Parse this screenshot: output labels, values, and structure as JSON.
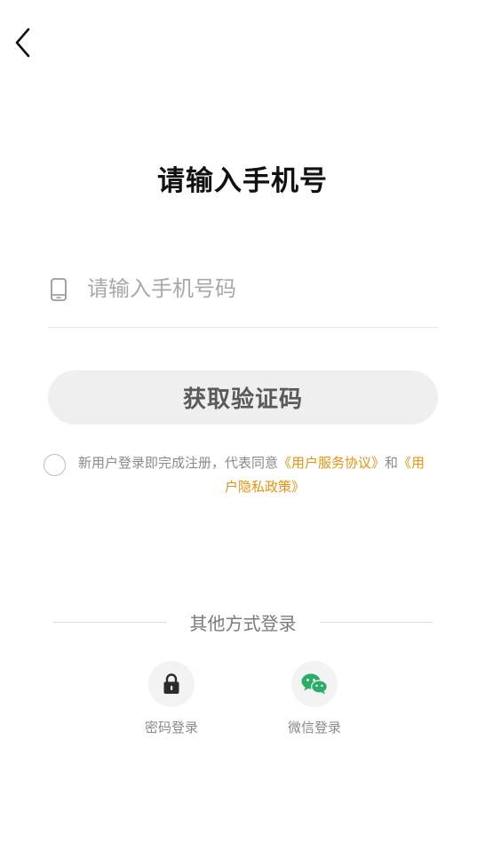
{
  "header": {
    "back_icon": "chevron-left-icon"
  },
  "title": "请输入手机号",
  "phone": {
    "icon": "mobile-phone-icon",
    "value": "",
    "placeholder": "请输入手机号码"
  },
  "get_code_button": "获取验证码",
  "agreement": {
    "checked": false,
    "prefix": "新用户登录即完成注册，代表同意",
    "terms_link": "《用户服务协议》",
    "joiner": "和",
    "privacy_link_part1": "《用",
    "privacy_link_part2": "户隐私政策》",
    "link_color": "#e8930f"
  },
  "other_login": {
    "divider_label": "其他方式登录",
    "options": [
      {
        "label": "密码登录",
        "icon": "lock-icon"
      },
      {
        "label": "微信登录",
        "icon": "wechat-icon",
        "icon_color": "#2aae67"
      }
    ]
  }
}
